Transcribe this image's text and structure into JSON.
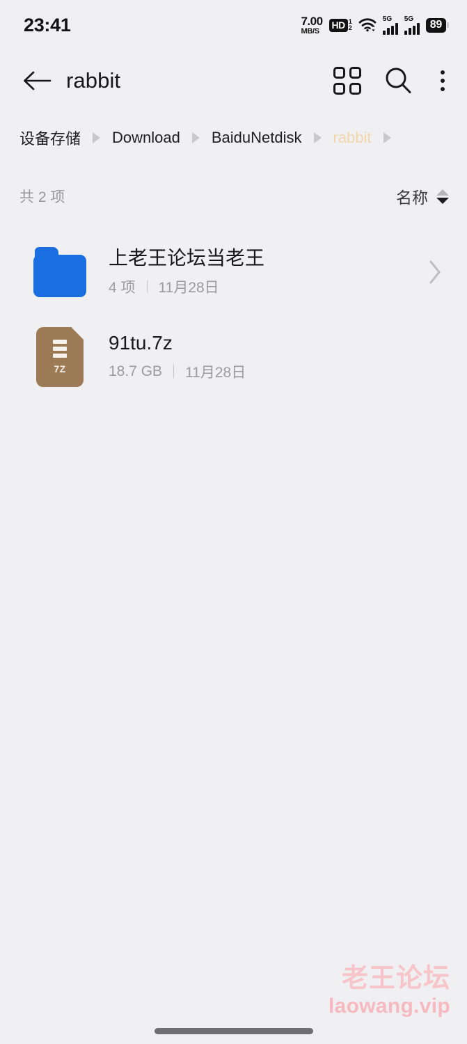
{
  "status_bar": {
    "time": "23:41",
    "net_speed_value": "7.00",
    "net_speed_unit": "MB/S",
    "hd_label": "HD",
    "hd_sim_top": "1",
    "hd_sim_bottom": "2",
    "wifi_icon": "wifi-icon",
    "sim1_label": "5G",
    "sim2_label": "5G",
    "battery_level": "89"
  },
  "app_bar": {
    "back_icon": "back-arrow-icon",
    "title": "rabbit",
    "grid_view_icon": "grid-view-icon",
    "search_icon": "search-icon",
    "overflow_icon": "more-vertical-icon"
  },
  "breadcrumb": {
    "items": [
      {
        "label": "设备存储",
        "current": false
      },
      {
        "label": "Download",
        "current": false
      },
      {
        "label": "BaiduNetdisk",
        "current": false
      },
      {
        "label": "rabbit",
        "current": true
      }
    ],
    "separator_icon": "caret-right-icon",
    "current_color": "#f3d5ab"
  },
  "list_header": {
    "count_text": "共 2 项",
    "sort_label": "名称",
    "sort_up_icon": "sort-ascending-icon",
    "sort_down_icon": "sort-descending-icon",
    "sort_active_direction": "descending"
  },
  "files": [
    {
      "type": "folder",
      "icon": "folder-icon",
      "icon_color": "#1a6ee0",
      "name": "上老王论坛当老王",
      "meta_primary": "4 项",
      "meta_date": "11月28日",
      "has_chevron": true,
      "chevron_icon": "chevron-right-icon"
    },
    {
      "type": "archive",
      "icon": "archive-7z-icon",
      "icon_color": "#9b7a55",
      "icon_label": "7Z",
      "name": "91tu.7z",
      "meta_primary": "18.7 GB",
      "meta_date": "11月28日",
      "has_chevron": false,
      "chevron_icon": ""
    }
  ],
  "watermark": {
    "line1": "老王论坛",
    "line2": "laowang.vip",
    "color": "#f7c4c9"
  },
  "system_nav": {
    "home_indicator": "home-indicator"
  }
}
